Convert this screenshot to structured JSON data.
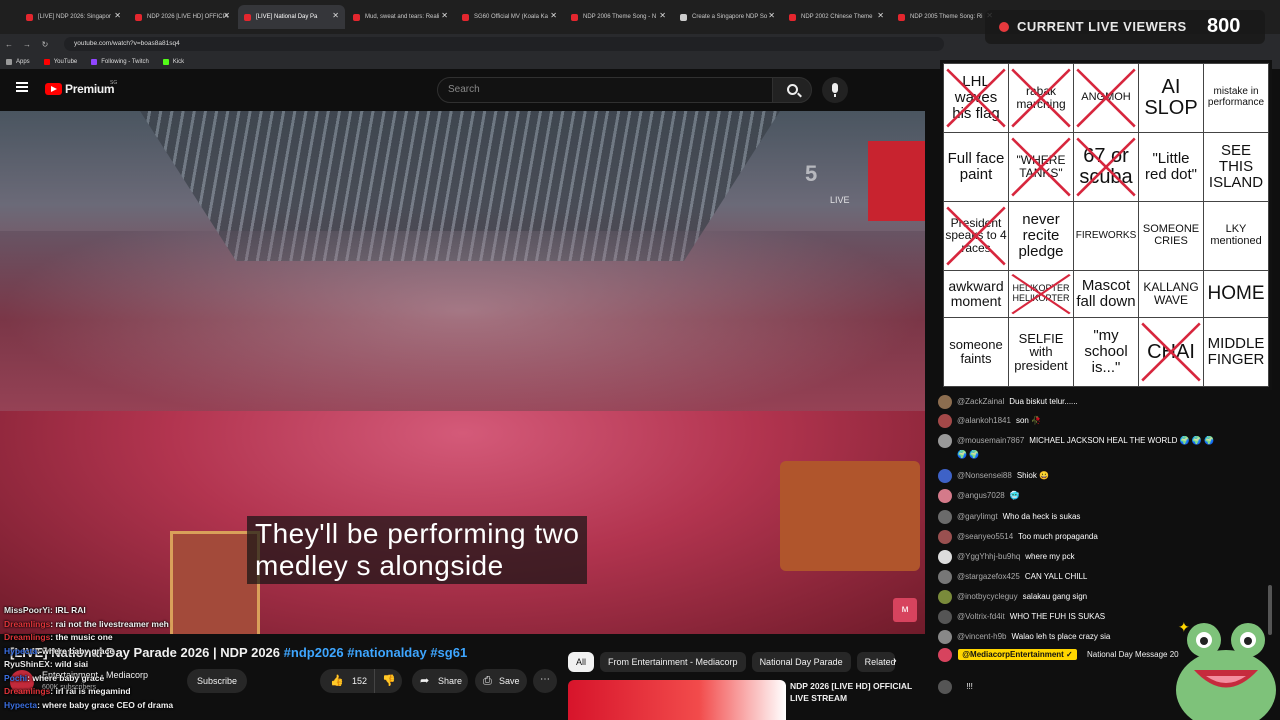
{
  "browser": {
    "tabs": [
      {
        "title": "[LIVE] NDP 2026: Singapor"
      },
      {
        "title": "NDP 2026 [LIVE HD] OFFICIA"
      },
      {
        "title": "[LIVE] National Day Pa"
      },
      {
        "title": "Mud, sweat and tears: Reali"
      },
      {
        "title": "SG60 Official MV (Koala Ka"
      },
      {
        "title": "NDP 2006 Theme Song - N"
      },
      {
        "title": "Create a Singapore NDP So"
      },
      {
        "title": "NDP 2002 Chinese Theme"
      },
      {
        "title": "NDP 2005 Theme Song: Ri"
      }
    ],
    "url": "youtube.com/watch?v=boas8a81sq4",
    "bookmarks": [
      "Apps",
      "YouTube",
      "Following - Twitch",
      "Kick"
    ]
  },
  "youtube": {
    "brand": "Premium",
    "brand_sup": "SG",
    "search_placeholder": "Search"
  },
  "video": {
    "caption_line1": "They'll be performing two",
    "caption_line2": "medley s alongside",
    "watermark": "5",
    "watermark_live": "LIVE",
    "title": "[LIVE] National Day Parade 2026 | NDP 2026",
    "hashtags": "#ndp2026 #nationalday #sg61",
    "channel": "Entertainment - Mediacorp",
    "subscribers": "600K subscribers",
    "subscribe_label": "Subscribe",
    "likes": "152",
    "share_label": "Share",
    "save_label": "Save"
  },
  "overlay_chat": [
    {
      "user": "MissPoorYi",
      "msg": "IRL RAI",
      "color": "#e8e8e8"
    },
    {
      "user": "Dreamlings",
      "msg": "rai not the livestreamer meh",
      "color": "#e0343a"
    },
    {
      "user": "Dreamlings",
      "msg": "the music one",
      "color": "#e0343a"
    },
    {
      "user": "Hypecta",
      "msg": "where baby grace",
      "color": "#3b6fe0"
    },
    {
      "user": "RyuShinEX",
      "msg": "wild siai",
      "color": "#e8e8e8"
    },
    {
      "user": "Pochi",
      "msg": "where baby grace",
      "color": "#3b6fe0"
    },
    {
      "user": "Dreamlings",
      "msg": "irl rai is megamind",
      "color": "#e0343a"
    },
    {
      "user": "Hypecta",
      "msg": "where baby grace CEO of drama",
      "color": "#3b6fe0"
    }
  ],
  "chips": [
    "All",
    "From Entertainment - Mediacorp",
    "National Day Parade",
    "Related"
  ],
  "recommendation": {
    "title": "NDP 2026 [LIVE HD] OFFICIAL LIVE STREAM"
  },
  "viewers": {
    "label": "CURRENT LIVE VIEWERS",
    "count": "800"
  },
  "bingo": [
    [
      {
        "text": "LHL waves his flag",
        "crossed": true,
        "size": 15
      },
      {
        "text": "rabak marching",
        "crossed": true,
        "size": 12
      },
      {
        "text": "ANGMOH",
        "crossed": true,
        "size": 11
      },
      {
        "text": "AI SLOP",
        "crossed": false,
        "size": 20
      },
      {
        "text": "mistake in performance",
        "crossed": false,
        "size": 10
      }
    ],
    [
      {
        "text": "Full face paint",
        "crossed": false,
        "size": 15
      },
      {
        "text": "\"WHERE TANKS\"",
        "crossed": true,
        "size": 12
      },
      {
        "text": "67 or scuba",
        "crossed": true,
        "size": 20
      },
      {
        "text": "\"Little red dot\"",
        "crossed": false,
        "size": 15
      },
      {
        "text": "SEE THIS ISLAND",
        "crossed": false,
        "size": 15
      }
    ],
    [
      {
        "text": "President speaks to 4 races",
        "crossed": true,
        "size": 12
      },
      {
        "text": "never recite pledge",
        "crossed": false,
        "size": 15
      },
      {
        "text": "FIREWORKS",
        "crossed": false,
        "size": 10
      },
      {
        "text": "SOMEONE CRIES",
        "crossed": false,
        "size": 11
      },
      {
        "text": "LKY mentioned",
        "crossed": false,
        "size": 11
      }
    ],
    [
      {
        "text": "awkward moment",
        "crossed": false,
        "size": 14
      },
      {
        "text": "HELIKOPTER HELIKOPTER",
        "crossed": true,
        "size": 9
      },
      {
        "text": "Mascot fall down",
        "crossed": false,
        "size": 15
      },
      {
        "text": "KALLANG WAVE",
        "crossed": false,
        "size": 12
      },
      {
        "text": "HOME",
        "crossed": false,
        "size": 19
      }
    ],
    [
      {
        "text": "someone faints",
        "crossed": false,
        "size": 13
      },
      {
        "text": "SELFIE with president",
        "crossed": false,
        "size": 13
      },
      {
        "text": "\"my school is...\"",
        "crossed": false,
        "size": 15
      },
      {
        "text": "CHAI",
        "crossed": true,
        "size": 20
      },
      {
        "text": "MIDDLE FINGER",
        "crossed": false,
        "size": 15
      }
    ]
  ],
  "live_chat": [
    {
      "author": "@ZackZainal",
      "text": "Dua biskut telur......",
      "color": "#8c6d4f"
    },
    {
      "author": "@alankoh1841",
      "text": "son 🥀",
      "color": "#a34848"
    },
    {
      "author": "@mousemain7867",
      "text": "MICHAEL JACKSON HEAL THE WORLD 🌍 🌍 🌍",
      "color": "#999"
    },
    {
      "author": "",
      "text": "🌍 🌍",
      "color": ""
    },
    {
      "author": "@Nonsensei88",
      "text": "Shiok 😀",
      "color": "#3e62c7"
    },
    {
      "author": "@angus7028",
      "text": "🥶",
      "color": "#d47a8a"
    },
    {
      "author": "@garylimgt",
      "text": "Who da heck is sukas",
      "color": "#6b6b6b"
    },
    {
      "author": "@seanyeo5514",
      "text": "Too much propaganda",
      "color": "#9a5050"
    },
    {
      "author": "@YggYhhj-bu9hq",
      "text": "where my pck",
      "color": "#dddddd"
    },
    {
      "author": "@stargazefox425",
      "text": "CAN YALL CHILL",
      "color": "#777"
    },
    {
      "author": "@inotbycycleguy",
      "text": "salakau gang sign",
      "color": "#7a8b3b"
    },
    {
      "author": "@Voltrix-fd4it",
      "text": "WHO THE FUH IS SUKAS",
      "color": "#555"
    },
    {
      "author": "@vincent-h9b",
      "text": "Walao leh ts place crazy sia",
      "color": "#888"
    }
  ],
  "pinned": {
    "badge": "@MediacorpEntertainment ✓",
    "text": "National Day Message 20"
  },
  "chat_input": "!!!"
}
